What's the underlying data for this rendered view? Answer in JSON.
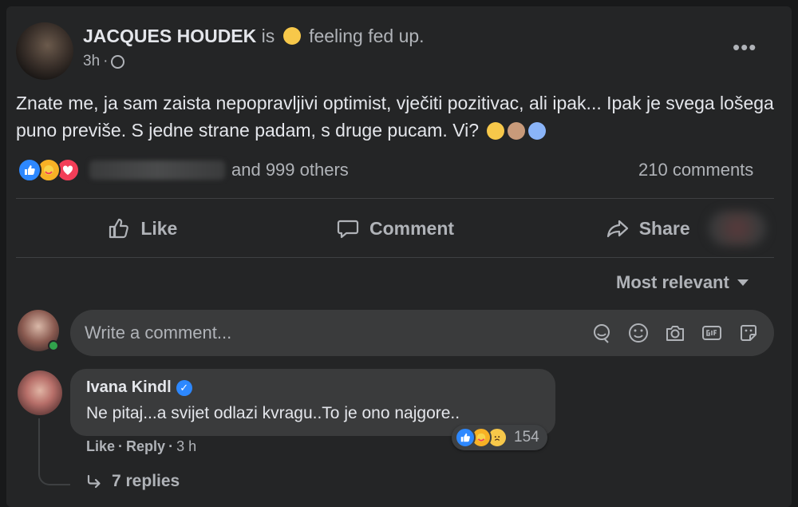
{
  "post": {
    "author": "JACQUES HOUDEK",
    "feeling_prefix": "is",
    "feeling_icon": "sad-face-icon",
    "feeling_text": "feeling fed up.",
    "time": "3h",
    "separator": "·",
    "privacy_icon": "globe-icon",
    "more_label": "•••",
    "text": "Znate me, ja sam zaista nepopravljivi optimist, vječiti pozitivac, ali ipak... Ipak je svega lošega puno previše. S jedne strane padam, s druge pucam. Vi?",
    "inline_emojis": [
      "exploding-head-icon",
      "facepalm-icon",
      "screaming-face-icon"
    ]
  },
  "reactions": {
    "icons": [
      "like-icon",
      "care-icon",
      "love-icon"
    ],
    "others_text": "and 999 others",
    "comments_count": "210 comments"
  },
  "actions": {
    "like": "Like",
    "comment": "Comment",
    "share": "Share"
  },
  "sort": {
    "label": "Most relevant"
  },
  "composer": {
    "placeholder": "Write a comment...",
    "tools": [
      "avatar-sticker-icon",
      "emoji-icon",
      "camera-icon",
      "gif-icon",
      "sticker-icon"
    ]
  },
  "comment": {
    "author": "Ivana Kindl",
    "text": "Ne pitaj...a svijet odlazi kvragu..To je ono najgore..",
    "reaction_count": "154",
    "like": "Like",
    "reply": "Reply",
    "time": "3 h",
    "dot": "·"
  },
  "replies": {
    "label": "7 replies"
  },
  "colors": {
    "background": "#18191a",
    "card": "#242526",
    "bubble": "#3a3b3c",
    "primary_text": "#e4e6eb",
    "secondary_text": "#b0b3b8",
    "like_blue": "#2d88ff",
    "love_red": "#f33e58",
    "online_green": "#31a24c"
  }
}
